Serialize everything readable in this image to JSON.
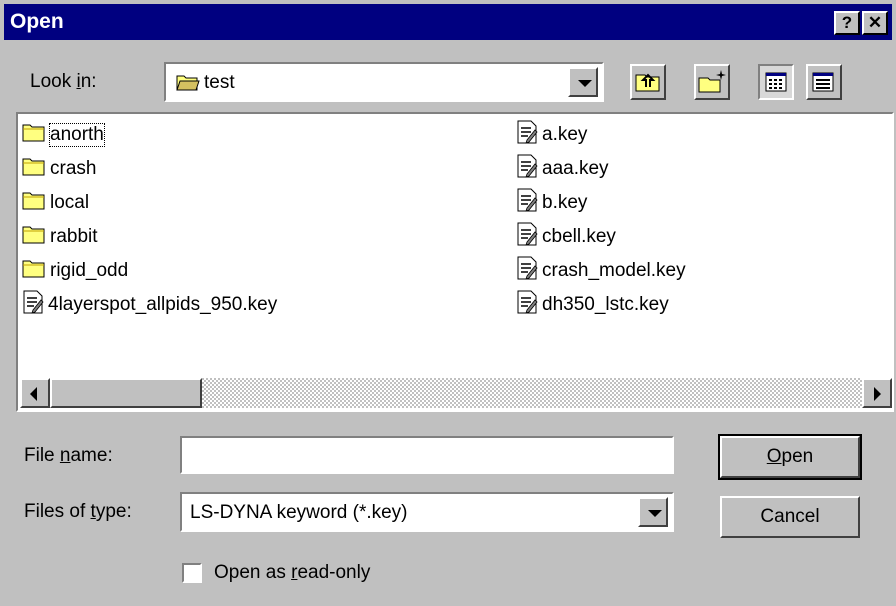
{
  "window": {
    "title": "Open",
    "help_btn": "?",
    "close_btn": "✕"
  },
  "look_in": {
    "label_pre": "Look ",
    "label_u": "i",
    "label_post": "n:",
    "value": "test"
  },
  "toolbar": {
    "up_icon": "up-one-level-icon",
    "new_folder_icon": "new-folder-icon",
    "list_icon": "list-view-icon",
    "details_icon": "details-view-icon"
  },
  "files": {
    "left": [
      {
        "name": "anorth",
        "type": "folder"
      },
      {
        "name": "crash",
        "type": "folder"
      },
      {
        "name": "local",
        "type": "folder"
      },
      {
        "name": "rabbit",
        "type": "folder"
      },
      {
        "name": "rigid_odd",
        "type": "folder"
      },
      {
        "name": "4layerspot_allpids_950.key",
        "type": "file"
      }
    ],
    "right": [
      {
        "name": "a.key",
        "type": "file"
      },
      {
        "name": "aaa.key",
        "type": "file"
      },
      {
        "name": "b.key",
        "type": "file"
      },
      {
        "name": "cbell.key",
        "type": "file"
      },
      {
        "name": "crash_model.key",
        "type": "file"
      },
      {
        "name": "dh350_lstc.key",
        "type": "file"
      }
    ]
  },
  "file_name": {
    "label_pre": "File ",
    "label_u": "n",
    "label_post": "ame:",
    "value": ""
  },
  "file_type": {
    "label_pre": "Files of ",
    "label_u": "t",
    "label_post": "ype:",
    "value": "LS-DYNA keyword (*.key)"
  },
  "read_only": {
    "label_pre": "Open as ",
    "label_u": "r",
    "label_post": "ead-only",
    "checked": false
  },
  "buttons": {
    "open_u": "O",
    "open_rest": "pen",
    "cancel": "Cancel"
  }
}
